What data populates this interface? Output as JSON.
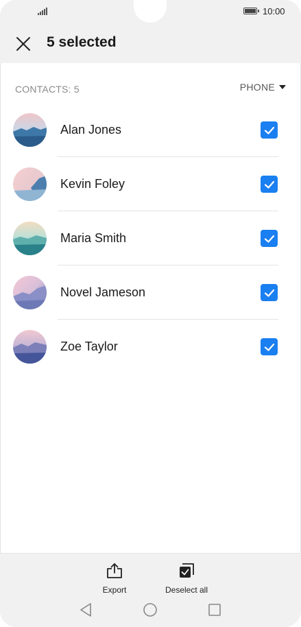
{
  "status_bar": {
    "time": "10:00"
  },
  "header": {
    "title": "5 selected"
  },
  "list_header": {
    "count_label": "CONTACTS: 5",
    "filter_label": "PHONE"
  },
  "contacts": [
    {
      "name": "Alan Jones",
      "checked": true
    },
    {
      "name": "Kevin Foley",
      "checked": true
    },
    {
      "name": "Maria Smith",
      "checked": true
    },
    {
      "name": "Novel Jameson",
      "checked": true
    },
    {
      "name": "Zoe Taylor",
      "checked": true
    }
  ],
  "bottom_actions": {
    "export_label": "Export",
    "deselect_label": "Deselect all"
  },
  "colors": {
    "accent": "#1a7ff0",
    "bar_bg": "#f1f1f1"
  }
}
